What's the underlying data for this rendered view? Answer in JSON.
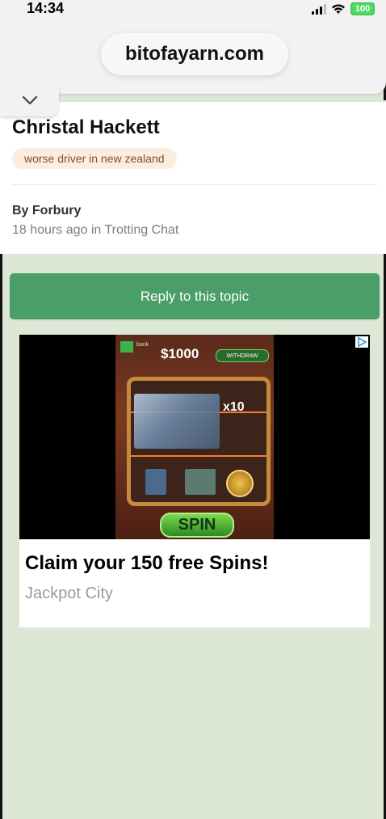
{
  "status_bar": {
    "time": "14:34",
    "battery": "100"
  },
  "browser": {
    "url": "bitofayarn.com",
    "collapse_icon": "chevron-down-icon"
  },
  "topic": {
    "title": "Christal Hackett",
    "tag": "worse driver in new zealand",
    "author": "By Forbury",
    "meta": "18 hours ago in Trotting Chat"
  },
  "actions": {
    "reply_label": "Reply to this topic"
  },
  "ad": {
    "creative": {
      "amount": "$1000",
      "withdraw": "WITHDRAW",
      "multiplier": "x10",
      "spin": "SPIN",
      "bank_label": "bank"
    },
    "headline": "Claim your 150 free Spins!",
    "advertiser": "Jackpot City"
  },
  "colors": {
    "page_background": "#dce8d5",
    "reply_button": "#4a9e67",
    "tag_background": "#fbeee0",
    "tag_text": "#8a4b22"
  }
}
